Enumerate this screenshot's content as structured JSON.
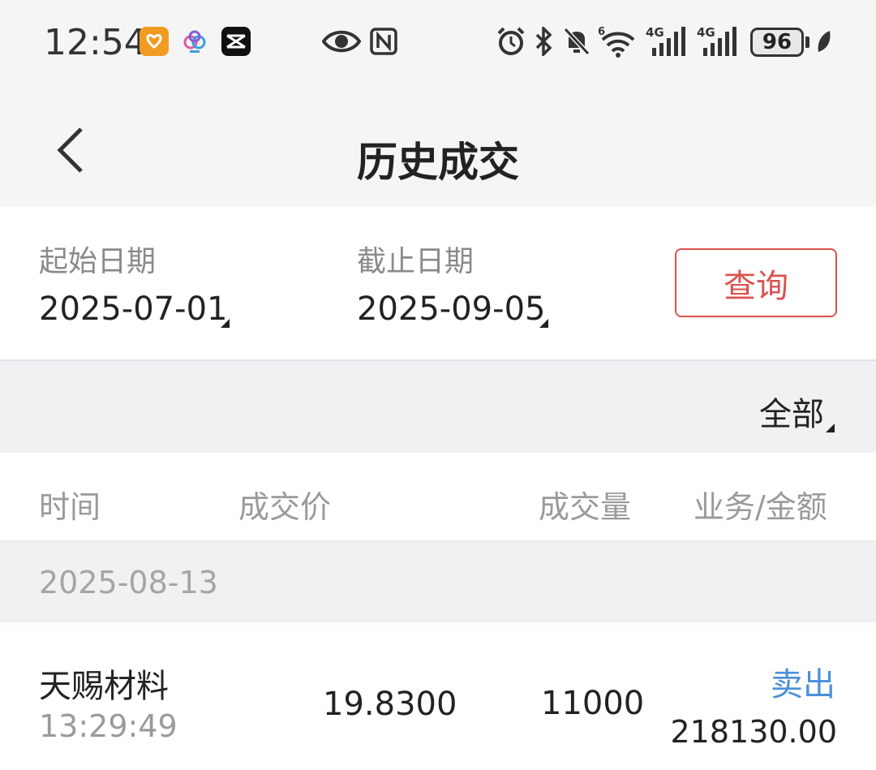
{
  "status_bar": {
    "time": "12:54",
    "battery": "96",
    "network1": "4G",
    "network2": "4G",
    "wifi_badge": "6"
  },
  "header": {
    "title": "历史成交"
  },
  "filter": {
    "start_label": "起始日期",
    "start_date": "2025-07-01",
    "end_label": "截止日期",
    "end_date": "2025-09-05",
    "query_button": "查询"
  },
  "type_filter": {
    "selected": "全部"
  },
  "columns": {
    "time": "时间",
    "price": "成交价",
    "volume": "成交量",
    "business_amount": "业务/金额"
  },
  "groups": [
    {
      "date": "2025-08-13",
      "trades": [
        {
          "name": "天赐材料",
          "time": "13:29:49",
          "price": "19.8300",
          "volume": "11000",
          "side": "卖出",
          "amount": "218130.00"
        }
      ]
    }
  ],
  "colors": {
    "accent_red": "#d9534f",
    "sell_blue": "#4a90d9"
  }
}
